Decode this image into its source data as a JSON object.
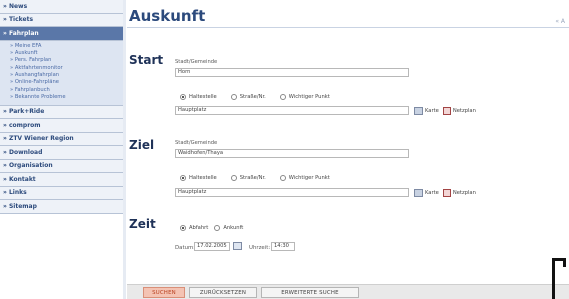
{
  "sidebar": {
    "items_top": [
      {
        "label": "» News"
      },
      {
        "label": "» Tickets"
      }
    ],
    "active": {
      "label": "» Fahrplan"
    },
    "sub_items": [
      {
        "label": "» Meine EFA"
      },
      {
        "label": "» Auskunft"
      },
      {
        "label": "» Pers. Fahrplan"
      },
      {
        "label": "» Aktfahrtenmonitor"
      },
      {
        "label": "» Aushangfahrplan"
      },
      {
        "label": "» Online-Fahrpläne"
      },
      {
        "label": "» Fahrplanbuch"
      },
      {
        "label": "» Bekannte Probleme"
      }
    ],
    "items_bottom": [
      {
        "label": "» Park+Ride"
      },
      {
        "label": "» comprom"
      },
      {
        "label": "» ZTV Wiener Region"
      },
      {
        "label": "» Download"
      },
      {
        "label": "» Organisation"
      },
      {
        "label": "» Kontakt"
      },
      {
        "label": "» Links"
      },
      {
        "label": "» Sitemap"
      }
    ]
  },
  "page": {
    "title": "Auskunft",
    "corner": "« A"
  },
  "start": {
    "label": "Start",
    "caption": "Stadt/Gemeinde",
    "city_value": "Horn",
    "radios": [
      "Haltestelle",
      "Straße/Nr.",
      "Wichtiger Punkt"
    ],
    "stop_value": "Hauptplatz",
    "map_label": "Karte",
    "net_label": "Netzplan"
  },
  "ziel": {
    "label": "Ziel",
    "caption": "Stadt/Gemeinde",
    "city_value": "Waidhofen/Thaya",
    "radios": [
      "Haltestelle",
      "Straße/Nr.",
      "Wichtiger Punkt"
    ],
    "stop_value": "Hauptplatz",
    "map_label": "Karte",
    "net_label": "Netzplan"
  },
  "zeit": {
    "label": "Zeit",
    "radios": [
      "Abfahrt",
      "Ankunft"
    ],
    "date_label": "Datum:",
    "date_value": "17.02.2005",
    "time_label": "Uhrzeit:",
    "time_value": "14:30"
  },
  "buttons": {
    "search": "SUCHEN",
    "reset": "ZURÜCKSETZEN",
    "advanced": "ERWEITERTE SUCHE"
  }
}
